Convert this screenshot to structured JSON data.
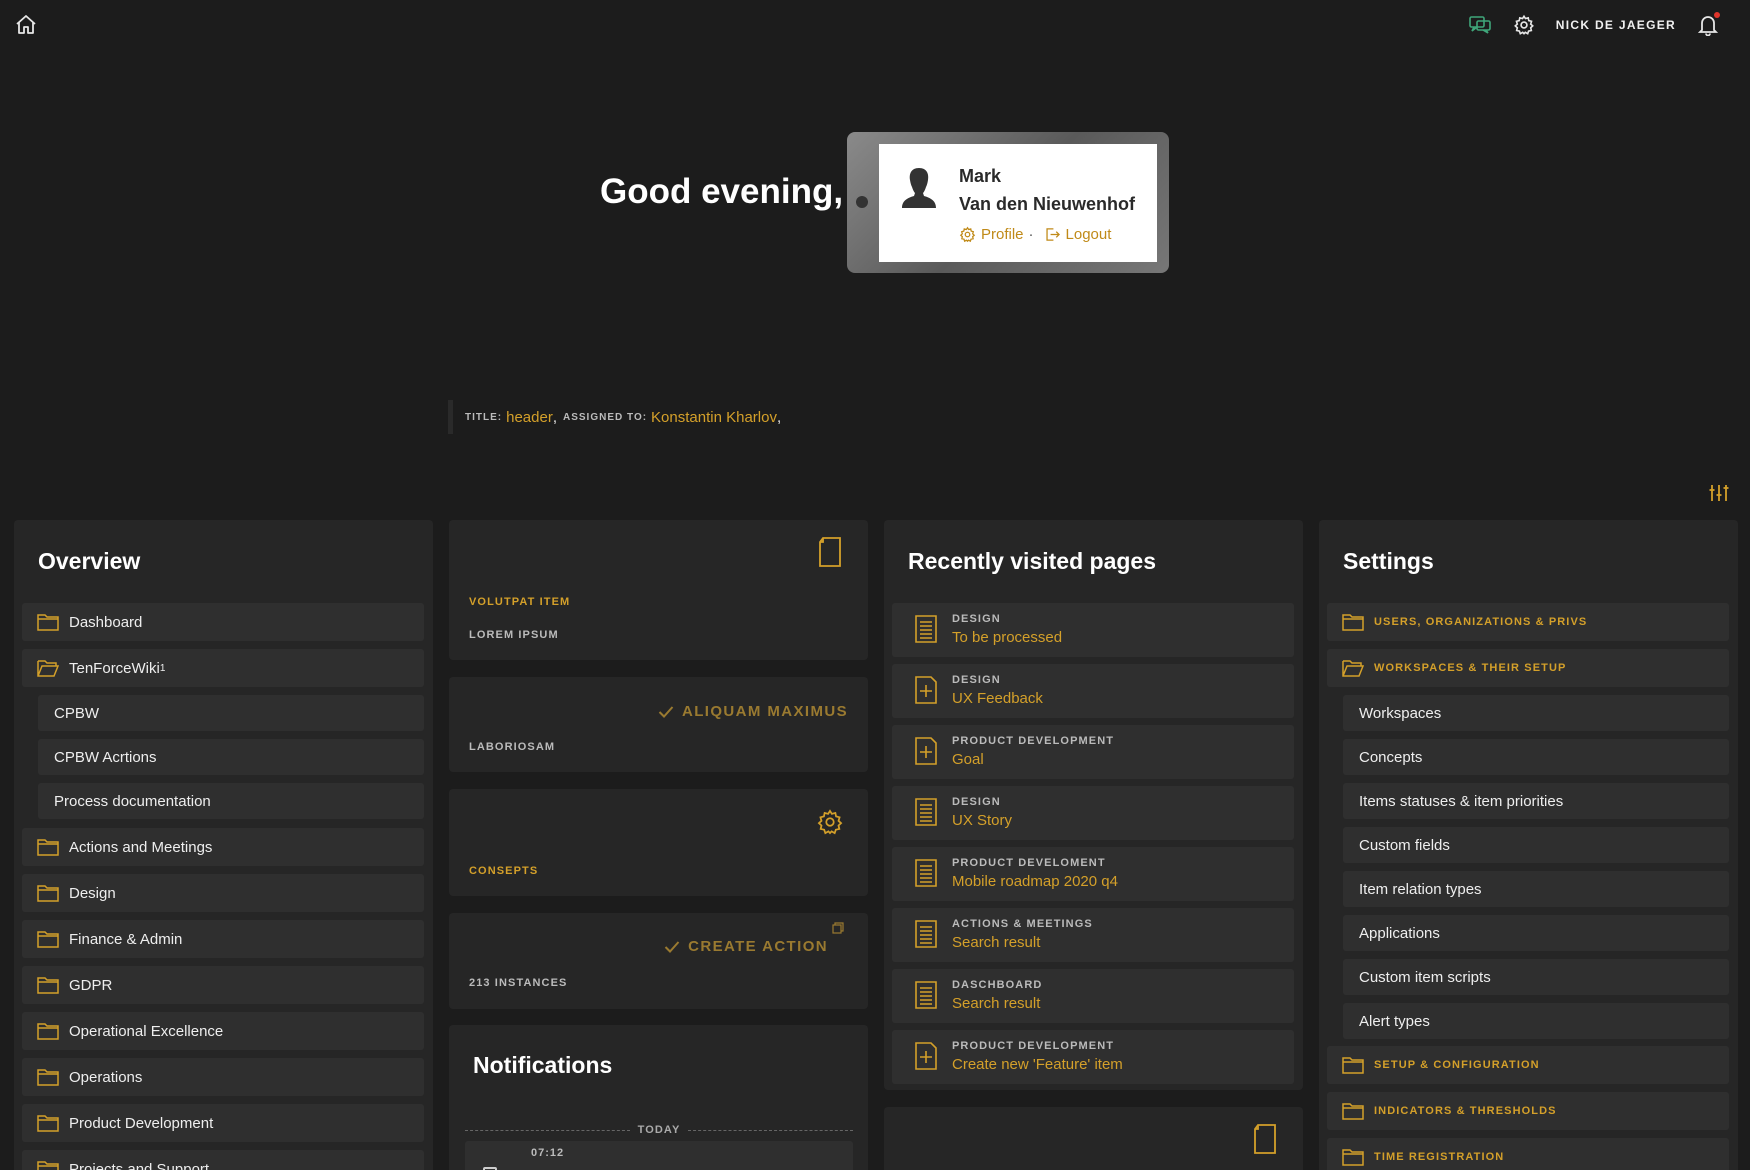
{
  "topbar": {
    "username": "NICK DE JAEGER",
    "colors": {
      "accent": "#d4a02a",
      "notification_dot": "#e0352b",
      "chat_icon": "#3fa67a"
    }
  },
  "greeting": {
    "text": "Good evening,",
    "first_name": "Mark",
    "last_name": "Van den Nieuwenhof",
    "profile_link": "Profile",
    "separator": "·",
    "logout_link": "Logout"
  },
  "filter": {
    "title_label": "TITLE:",
    "title_value": "header",
    "assigned_label": "ASSIGNED TO:",
    "assigned_value": "Konstantin Kharlov",
    "comma": ","
  },
  "overview": {
    "title": "Overview",
    "items": [
      {
        "label": "Dashboard",
        "type": "folder"
      },
      {
        "label": "TenForceWiki",
        "type": "folder-open",
        "sup": "1"
      },
      {
        "label": "CPBW",
        "type": "sub"
      },
      {
        "label": "CPBW Acrtions",
        "type": "sub"
      },
      {
        "label": "Process documentation",
        "type": "sub"
      },
      {
        "label": "Actions and Meetings",
        "type": "folder"
      },
      {
        "label": "Design",
        "type": "folder"
      },
      {
        "label": "Finance & Admin",
        "type": "folder"
      },
      {
        "label": "GDPR",
        "type": "folder"
      },
      {
        "label": "Operational Excellence",
        "type": "folder"
      },
      {
        "label": "Operations",
        "type": "folder"
      },
      {
        "label": "Product Development",
        "type": "folder"
      },
      {
        "label": "Projects and Support",
        "type": "folder"
      }
    ]
  },
  "cards": {
    "volutpat": {
      "title": "VOLUTPAT ITEM",
      "subtitle": "LOREM IPSUM",
      "icon": "document-icon"
    },
    "aliquam": {
      "action": "ALIQUAM MAXIMUS",
      "subtitle": "LABORIOSAM",
      "icon": "check-icon"
    },
    "consepts": {
      "title": "CONSEPTS",
      "icon": "gear-icon"
    },
    "create": {
      "action": "CREATE ACTION",
      "subtitle": "213 INSTANCES",
      "icon": "check-icon"
    }
  },
  "notifications": {
    "title": "Notifications",
    "today": "TODAY",
    "first_time": "07:12"
  },
  "recent": {
    "title": "Recently visited pages",
    "items": [
      {
        "category": "DESIGN",
        "title": "To be processed",
        "icon": "list-doc-icon"
      },
      {
        "category": "DESIGN",
        "title": "UX Feedback",
        "icon": "add-doc-icon"
      },
      {
        "category": "PRODUCT DEVELOPMENT",
        "title": "Goal",
        "icon": "add-doc-icon"
      },
      {
        "category": "DESIGN",
        "title": "UX Story",
        "icon": "list-doc-icon"
      },
      {
        "category": "PRODUCT DEVELOMENT",
        "title": "Mobile roadmap 2020 q4",
        "icon": "list-doc-icon"
      },
      {
        "category": "ACTIONS & MEETINGS",
        "title": "Search result",
        "icon": "list-doc-icon"
      },
      {
        "category": "DASCHBOARD",
        "title": "Search result",
        "icon": "list-doc-icon"
      },
      {
        "category": "PRODUCT DEVELOPMENT",
        "title": "Create new 'Feature' item",
        "icon": "add-doc-icon"
      }
    ]
  },
  "settings": {
    "title": "Settings",
    "group1": "USERS, ORGANIZATIONS & PRIVS",
    "group2": "WORKSPACES & THEIR SETUP",
    "sub_items": [
      "Workspaces",
      "Concepts",
      "Items statuses & item priorities",
      "Custom fields",
      "Item relation types",
      "Applications",
      "Custom item scripts",
      "Alert types"
    ],
    "group3": "SETUP & CONFIGURATION",
    "group4": "INDICATORS & THRESHOLDS",
    "group5": "TIME REGISTRATION"
  }
}
